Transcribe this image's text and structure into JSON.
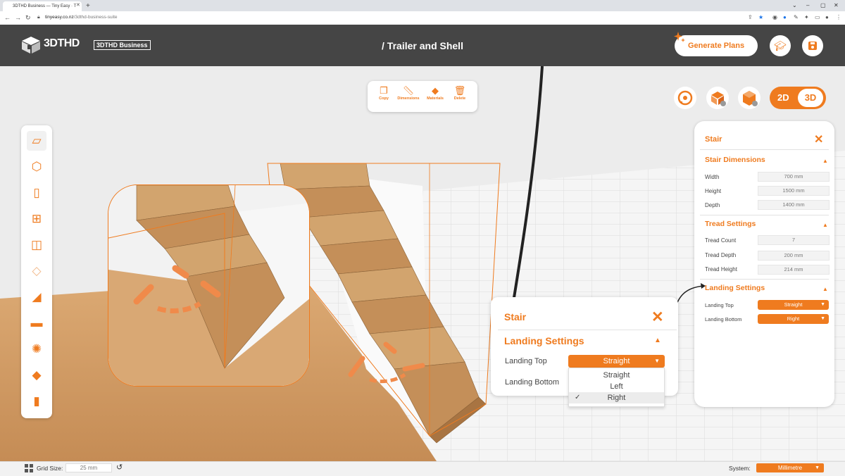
{
  "browser": {
    "tab_title": "3DTHD Business — Tiny Easy · T",
    "url_domain": "tinyeasy.co.nz",
    "url_path": "/3dthd-business-suite"
  },
  "header": {
    "logo_text": "3DTHD",
    "business_badge": "3DTHD Business",
    "page_title": "/ Trailer and Shell",
    "generate_label": "Generate Plans"
  },
  "toolbar": {
    "items": [
      {
        "label": "Copy",
        "icon": "copy-icon"
      },
      {
        "label": "Dimensions",
        "icon": "ruler-icon"
      },
      {
        "label": "Materials",
        "icon": "paint-bucket-icon"
      },
      {
        "label": "Delete",
        "icon": "trash-icon"
      }
    ]
  },
  "view_toggle": {
    "two_d": "2D",
    "three_d": "3D",
    "active": "3D"
  },
  "stair_panel": {
    "title": "Stair",
    "dimensions_title": "Stair Dimensions",
    "width_label": "Width",
    "width_value": "700 mm",
    "height_label": "Height",
    "height_value": "1500 mm",
    "depth_label": "Depth",
    "depth_value": "1400 mm",
    "tread_title": "Tread Settings",
    "tread_count_label": "Tread Count",
    "tread_count_value": "7",
    "tread_depth_label": "Tread Depth",
    "tread_depth_value": "200 mm",
    "tread_height_label": "Tread Height",
    "tread_height_value": "214 mm",
    "landing_title": "Landing Settings",
    "landing_top_label": "Landing Top",
    "landing_top_value": "Straight",
    "landing_bottom_label": "Landing Bottom",
    "landing_bottom_value": "Right"
  },
  "popup": {
    "title": "Stair",
    "section": "Landing Settings",
    "landing_top_label": "Landing Top",
    "landing_top_value": "Straight",
    "landing_bottom_label": "Landing Bottom",
    "options": [
      "Straight",
      "Left",
      "Right"
    ],
    "selected_option": "Right"
  },
  "footer": {
    "grid_label": "Grid Size:",
    "grid_value": "25 mm",
    "system_label": "System:",
    "system_value": "Millimetre"
  },
  "colors": {
    "accent": "#ef7b1f",
    "header_bg": "#454545",
    "wood": "#c99a62"
  }
}
